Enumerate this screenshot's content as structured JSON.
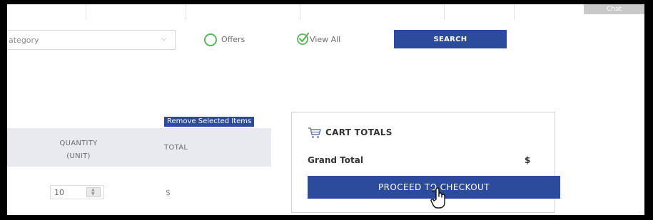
{
  "topnav": {
    "chat_label": "Chat"
  },
  "filters": {
    "category_value": "ategory",
    "offers_label": "Offers",
    "viewall_label": "View All",
    "search_label": "SEARCH"
  },
  "cart": {
    "remove_label": "Remove Selected Items",
    "columns": {
      "quantity": "QUANTITY",
      "unit": "(UNIT)",
      "total": "TOTAL"
    },
    "rows": [
      {
        "quantity": "10",
        "total": "$"
      }
    ]
  },
  "totals": {
    "title": "CART TOTALS",
    "grand_label": "Grand Total",
    "grand_value": "$",
    "checkout_label": "PROCEED TO CHECKOUT"
  },
  "colors": {
    "primary": "#2d4b9c",
    "radio": "#5bb65a"
  }
}
